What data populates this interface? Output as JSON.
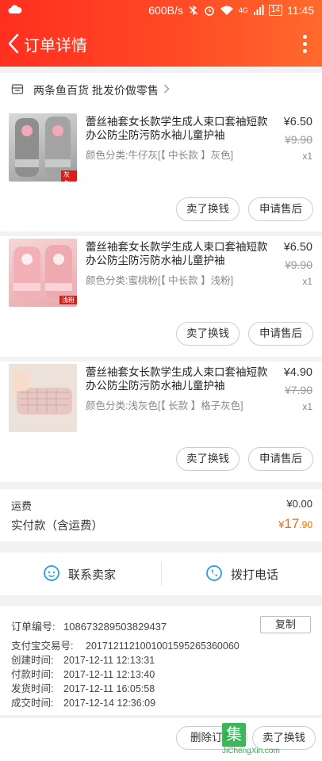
{
  "status_bar": {
    "speed": "600B/s",
    "network": "4G",
    "battery": "14",
    "time": "11:45"
  },
  "header": {
    "title": "订单详情"
  },
  "shop": {
    "name": "两条鱼百货 批发价做零售"
  },
  "items": [
    {
      "name": "蕾丝袖套女长款学生成人束口套袖短款办公防尘防污防水袖儿童护袖",
      "variant": "颜色分类:牛仔灰[【 中长款 】灰色]",
      "price": "¥6.50",
      "original_price": "¥9.90",
      "qty": "x1",
      "thumb_tag": "灰色",
      "btn_exchange": "卖了换钱",
      "btn_aftersale": "申请售后"
    },
    {
      "name": "蕾丝袖套女长款学生成人束口套袖短款办公防尘防污防水袖儿童护袖",
      "variant": "颜色分类:蜜桃粉[【 中长款 】浅粉]",
      "price": "¥6.50",
      "original_price": "¥9.90",
      "qty": "x1",
      "thumb_tag": "浅粉",
      "btn_exchange": "卖了换钱",
      "btn_aftersale": "申请售后"
    },
    {
      "name": "蕾丝袖套女长款学生成人束口套袖短款办公防尘防污防水袖儿童护袖",
      "variant": "颜色分类:浅灰色[【 长款 】格子灰色]",
      "price": "¥4.90",
      "original_price": "¥7.90",
      "qty": "x1",
      "thumb_tag": "",
      "btn_exchange": "卖了换钱",
      "btn_aftersale": "申请售后"
    }
  ],
  "totals": {
    "shipping_label": "运费",
    "shipping_value": "¥0.00",
    "paid_label": "实付款（含运费）",
    "paid_currency": "¥",
    "paid_int": "17",
    "paid_dec": ".90"
  },
  "contact": {
    "seller_label": "联系卖家",
    "call_label": "拨打电话"
  },
  "order_info": {
    "copy_label": "复制",
    "rows": [
      {
        "k": "订单编号:",
        "v": "108673289503829437"
      },
      {
        "k": "支付宝交易号:",
        "v": "2017121121001001595265360060"
      },
      {
        "k": "创建时间:",
        "v": "2017-12-11 12:13:31"
      },
      {
        "k": "付款时间:",
        "v": "2017-12-11 12:13:40"
      },
      {
        "k": "发货时间:",
        "v": "2017-12-11 16:05:58"
      },
      {
        "k": "成交时间:",
        "v": "2017-12-14 12:36:09"
      }
    ]
  },
  "footer": {
    "delete_label": "删除订单",
    "exchange_label": "卖了换钱"
  },
  "watermark": {
    "char": "集",
    "url": "JiChengXin.com"
  },
  "colors": {
    "accent": "#ff3b22",
    "price_orange": "#ff6a00",
    "icon_blue": "#1ea0e6"
  }
}
